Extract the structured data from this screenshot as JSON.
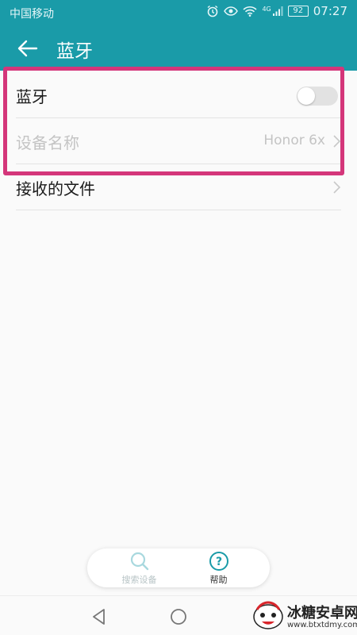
{
  "status_bar": {
    "carrier": "中国移动",
    "network": "4G",
    "battery": "92",
    "time": "07:27"
  },
  "app_bar": {
    "title": "蓝牙",
    "back_icon": "arrow-left-icon"
  },
  "rows": [
    {
      "label": "蓝牙",
      "control": "toggle",
      "toggle_on": false
    },
    {
      "label": "设备名称",
      "value": "Honor 6x",
      "disabled": true
    },
    {
      "label": "接收的文件"
    }
  ],
  "bottom_actions": [
    {
      "label": "搜索设备",
      "icon": "search-icon",
      "disabled": true
    },
    {
      "label": "帮助",
      "icon": "help-icon",
      "disabled": false
    }
  ],
  "nav_bar": {
    "icons": [
      "back-triangle-icon",
      "home-circle-icon",
      "recents-square-icon"
    ]
  },
  "watermark": {
    "title": "冰糖安卓网",
    "url": "www.btxtdmy.com"
  },
  "colors": {
    "primary": "#1a9ba8",
    "highlight": "#d4367a",
    "disabled_text": "#c4c4c4",
    "toggle_off": "#e2e2e2"
  }
}
